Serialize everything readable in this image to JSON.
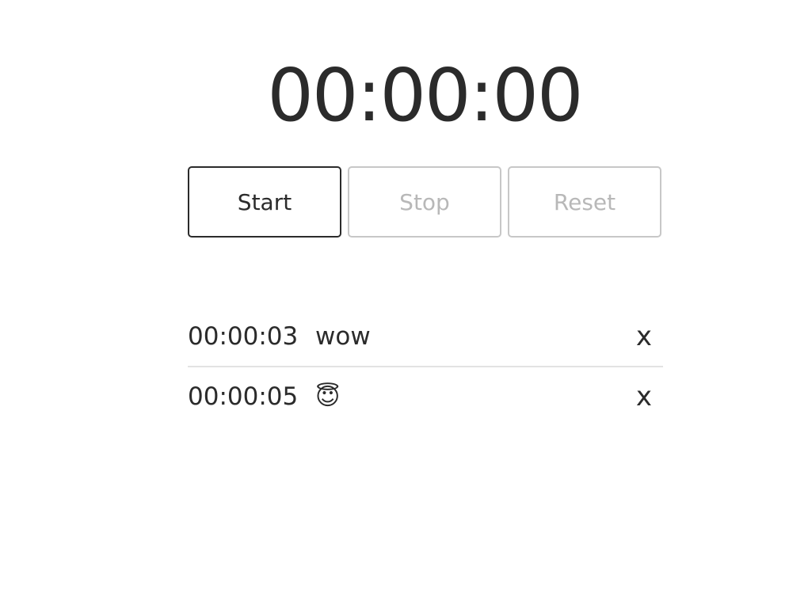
{
  "stopwatch": {
    "display": "00:00:00"
  },
  "controls": {
    "start_label": "Start",
    "stop_label": "Stop",
    "reset_label": "Reset"
  },
  "laps": [
    {
      "time": "00:00:03",
      "note": "wow",
      "delete_label": "x"
    },
    {
      "time": "00:00:05",
      "note": "😇",
      "delete_label": "x"
    }
  ],
  "colors": {
    "text": "#2b2b2b",
    "disabled_text": "#b8b8b8",
    "disabled_border": "#c7c7c7",
    "divider": "#e3e3e3"
  }
}
